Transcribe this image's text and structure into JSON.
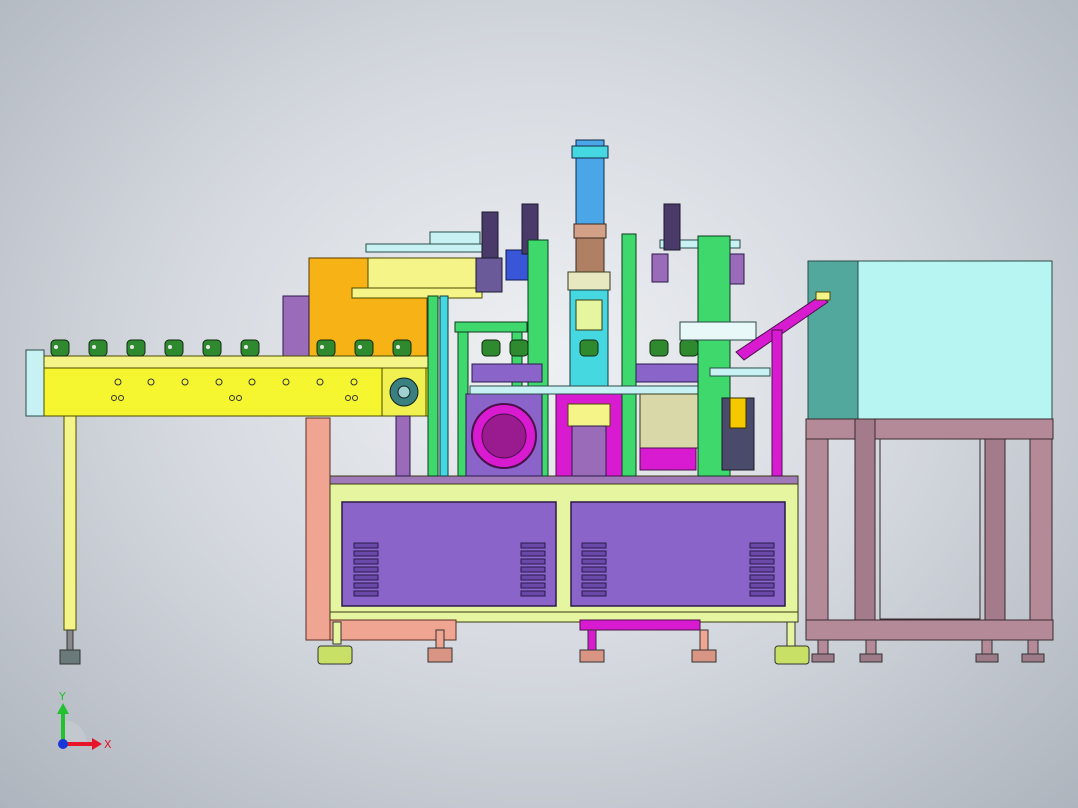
{
  "viewport": {
    "background_center": "#eef0f3",
    "background_edge": "#aeb4bd"
  },
  "triad": {
    "x_label": "X",
    "y_label": "Y",
    "x_color": "#e8142a",
    "y_color": "#22c12e",
    "origin_color": "#1a35d8"
  },
  "colors": {
    "conveyor_yellow": "#f5f530",
    "conveyor_top": "#f4f489",
    "base_frame": "#e6f5a0",
    "panel_purple": "#8a64c9",
    "leg_pink": "#f0a593",
    "cabinet_cyan": "#b6f5f1",
    "cabinet_teal": "#52a89c",
    "stand_mauve": "#b58a98",
    "orange_block": "#f7b215",
    "green_frame": "#3fd86c",
    "cyan_column": "#45d8e0",
    "magenta": "#d81ad0",
    "part_green": "#2f8a2f",
    "blue_cylinder": "#4aa6e6"
  }
}
